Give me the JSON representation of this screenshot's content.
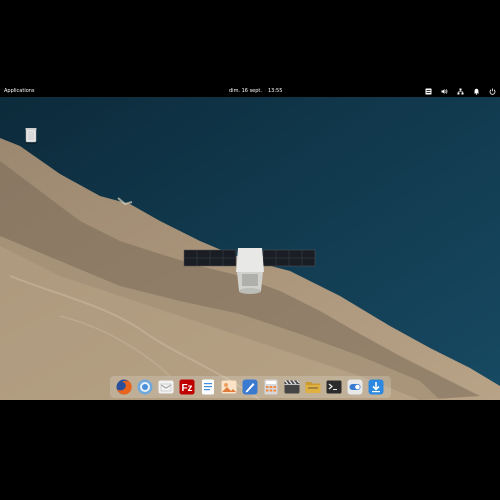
{
  "panel": {
    "applications_label": "Applications",
    "date": "dim. 16 sept.",
    "time": "13:55",
    "indicators": [
      "keyboard-icon",
      "volume-icon",
      "network-icon",
      "notifications-icon",
      "power-icon"
    ]
  },
  "desktop": {
    "icons": [
      {
        "name": "trash-icon",
        "label": ""
      }
    ]
  },
  "dock": {
    "apps": [
      {
        "name": "firefox-icon",
        "color": "#e8641b"
      },
      {
        "name": "chromium-icon",
        "color": "#4a90d9"
      },
      {
        "name": "mail-icon",
        "color": "#f2f2f2"
      },
      {
        "name": "filezilla-icon",
        "color": "#bf0000"
      },
      {
        "name": "text-editor-icon",
        "color": "#3b8ee0"
      },
      {
        "name": "photos-icon",
        "color": "#f0a060"
      },
      {
        "name": "pen-icon",
        "color": "#3a7ad0"
      },
      {
        "name": "calculator-icon",
        "color": "#d8d8d8"
      },
      {
        "name": "videos-icon",
        "color": "#444444"
      },
      {
        "name": "files-icon",
        "color": "#e0b040"
      },
      {
        "name": "terminal-icon",
        "color": "#2b2b2b"
      },
      {
        "name": "settings-toggle-icon",
        "color": "#e8e8e8"
      },
      {
        "name": "download-icon",
        "color": "#2c88e0"
      }
    ]
  }
}
